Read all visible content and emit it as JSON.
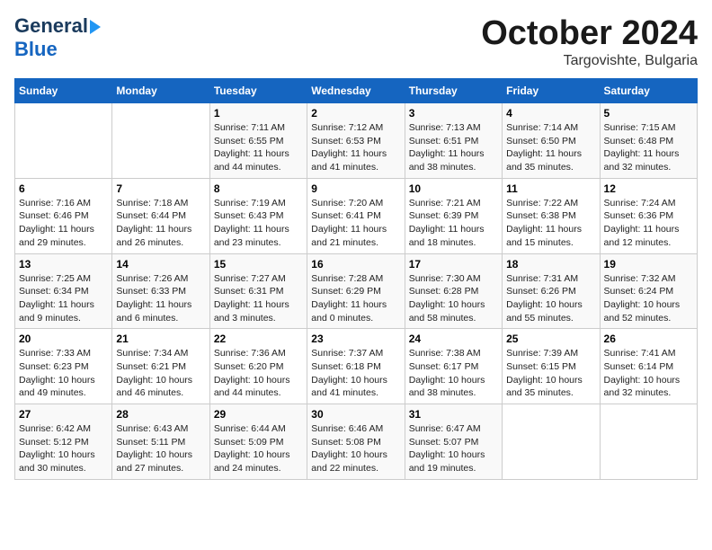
{
  "header": {
    "logo_line1": "General",
    "logo_line2": "Blue",
    "month": "October 2024",
    "location": "Targovishte, Bulgaria"
  },
  "days_of_week": [
    "Sunday",
    "Monday",
    "Tuesday",
    "Wednesday",
    "Thursday",
    "Friday",
    "Saturday"
  ],
  "weeks": [
    [
      {
        "day": "",
        "info": ""
      },
      {
        "day": "",
        "info": ""
      },
      {
        "day": "1",
        "info": "Sunrise: 7:11 AM\nSunset: 6:55 PM\nDaylight: 11 hours and 44 minutes."
      },
      {
        "day": "2",
        "info": "Sunrise: 7:12 AM\nSunset: 6:53 PM\nDaylight: 11 hours and 41 minutes."
      },
      {
        "day": "3",
        "info": "Sunrise: 7:13 AM\nSunset: 6:51 PM\nDaylight: 11 hours and 38 minutes."
      },
      {
        "day": "4",
        "info": "Sunrise: 7:14 AM\nSunset: 6:50 PM\nDaylight: 11 hours and 35 minutes."
      },
      {
        "day": "5",
        "info": "Sunrise: 7:15 AM\nSunset: 6:48 PM\nDaylight: 11 hours and 32 minutes."
      }
    ],
    [
      {
        "day": "6",
        "info": "Sunrise: 7:16 AM\nSunset: 6:46 PM\nDaylight: 11 hours and 29 minutes."
      },
      {
        "day": "7",
        "info": "Sunrise: 7:18 AM\nSunset: 6:44 PM\nDaylight: 11 hours and 26 minutes."
      },
      {
        "day": "8",
        "info": "Sunrise: 7:19 AM\nSunset: 6:43 PM\nDaylight: 11 hours and 23 minutes."
      },
      {
        "day": "9",
        "info": "Sunrise: 7:20 AM\nSunset: 6:41 PM\nDaylight: 11 hours and 21 minutes."
      },
      {
        "day": "10",
        "info": "Sunrise: 7:21 AM\nSunset: 6:39 PM\nDaylight: 11 hours and 18 minutes."
      },
      {
        "day": "11",
        "info": "Sunrise: 7:22 AM\nSunset: 6:38 PM\nDaylight: 11 hours and 15 minutes."
      },
      {
        "day": "12",
        "info": "Sunrise: 7:24 AM\nSunset: 6:36 PM\nDaylight: 11 hours and 12 minutes."
      }
    ],
    [
      {
        "day": "13",
        "info": "Sunrise: 7:25 AM\nSunset: 6:34 PM\nDaylight: 11 hours and 9 minutes."
      },
      {
        "day": "14",
        "info": "Sunrise: 7:26 AM\nSunset: 6:33 PM\nDaylight: 11 hours and 6 minutes."
      },
      {
        "day": "15",
        "info": "Sunrise: 7:27 AM\nSunset: 6:31 PM\nDaylight: 11 hours and 3 minutes."
      },
      {
        "day": "16",
        "info": "Sunrise: 7:28 AM\nSunset: 6:29 PM\nDaylight: 11 hours and 0 minutes."
      },
      {
        "day": "17",
        "info": "Sunrise: 7:30 AM\nSunset: 6:28 PM\nDaylight: 10 hours and 58 minutes."
      },
      {
        "day": "18",
        "info": "Sunrise: 7:31 AM\nSunset: 6:26 PM\nDaylight: 10 hours and 55 minutes."
      },
      {
        "day": "19",
        "info": "Sunrise: 7:32 AM\nSunset: 6:24 PM\nDaylight: 10 hours and 52 minutes."
      }
    ],
    [
      {
        "day": "20",
        "info": "Sunrise: 7:33 AM\nSunset: 6:23 PM\nDaylight: 10 hours and 49 minutes."
      },
      {
        "day": "21",
        "info": "Sunrise: 7:34 AM\nSunset: 6:21 PM\nDaylight: 10 hours and 46 minutes."
      },
      {
        "day": "22",
        "info": "Sunrise: 7:36 AM\nSunset: 6:20 PM\nDaylight: 10 hours and 44 minutes."
      },
      {
        "day": "23",
        "info": "Sunrise: 7:37 AM\nSunset: 6:18 PM\nDaylight: 10 hours and 41 minutes."
      },
      {
        "day": "24",
        "info": "Sunrise: 7:38 AM\nSunset: 6:17 PM\nDaylight: 10 hours and 38 minutes."
      },
      {
        "day": "25",
        "info": "Sunrise: 7:39 AM\nSunset: 6:15 PM\nDaylight: 10 hours and 35 minutes."
      },
      {
        "day": "26",
        "info": "Sunrise: 7:41 AM\nSunset: 6:14 PM\nDaylight: 10 hours and 32 minutes."
      }
    ],
    [
      {
        "day": "27",
        "info": "Sunrise: 6:42 AM\nSunset: 5:12 PM\nDaylight: 10 hours and 30 minutes."
      },
      {
        "day": "28",
        "info": "Sunrise: 6:43 AM\nSunset: 5:11 PM\nDaylight: 10 hours and 27 minutes."
      },
      {
        "day": "29",
        "info": "Sunrise: 6:44 AM\nSunset: 5:09 PM\nDaylight: 10 hours and 24 minutes."
      },
      {
        "day": "30",
        "info": "Sunrise: 6:46 AM\nSunset: 5:08 PM\nDaylight: 10 hours and 22 minutes."
      },
      {
        "day": "31",
        "info": "Sunrise: 6:47 AM\nSunset: 5:07 PM\nDaylight: 10 hours and 19 minutes."
      },
      {
        "day": "",
        "info": ""
      },
      {
        "day": "",
        "info": ""
      }
    ]
  ]
}
